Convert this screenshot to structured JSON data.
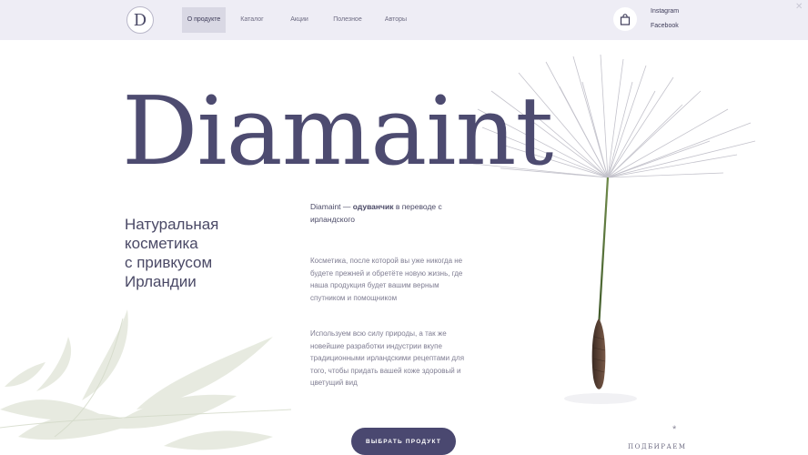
{
  "header": {
    "logo_letter": "D",
    "nav": [
      {
        "label": "О продукте",
        "active": true
      },
      {
        "label": "Каталог"
      },
      {
        "label": "Акции"
      },
      {
        "label": "Полезное"
      },
      {
        "label": "Авторы"
      }
    ],
    "social": [
      "Instagram",
      "Facebook"
    ]
  },
  "hero": {
    "brand": "Diamaint",
    "tagline": [
      "Натуральная",
      "косметика",
      "с привкусом",
      "Ирландии"
    ],
    "lead_strong_1": "Diamaint — ",
    "lead_bold": "одуванчик",
    "lead_rest": " в переводе с ирландского",
    "para_1": "Косметика, после которой вы уже никогда не будете прежней и обретёте новую жизнь, где наша продукция будет вашим верным спутником и помощником",
    "para_2": "Используем всю силу природы, а так же новейшие разработки индустрии вкупе традиционными ирландскими рецептами для того, чтобы придать вашей коже здоровый и цветущий вид",
    "cta_label": "ВЫБРАТЬ ПРОДУКТ",
    "pick_label": "ПОДБИРАЕМ",
    "star": "*"
  },
  "colors": {
    "brand": "#4d4b70",
    "header_bg": "#eeedf5",
    "cta_bg": "#4a4870"
  },
  "icons": [
    "shopping-bag-icon",
    "close-icon",
    "dandelion-illustration",
    "leaves-illustration"
  ]
}
